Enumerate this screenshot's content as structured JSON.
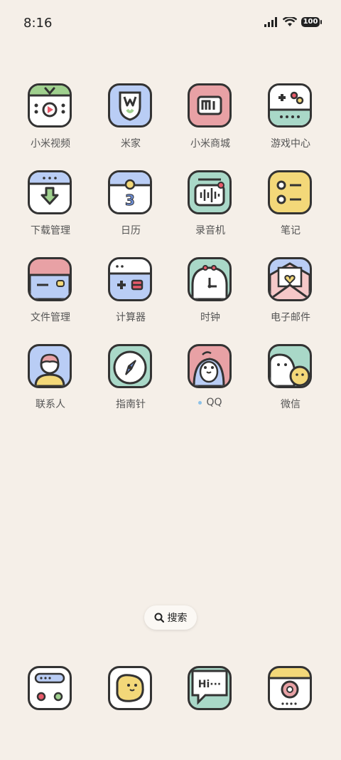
{
  "status": {
    "time": "8:16",
    "battery": "100",
    "icons": [
      "signal-icon",
      "wifi-icon",
      "battery-icon"
    ]
  },
  "apps": [
    {
      "label": "小米视频",
      "icon": "tv-play-icon"
    },
    {
      "label": "米家",
      "icon": "mijia-icon"
    },
    {
      "label": "小米商城",
      "icon": "mi-store-icon"
    },
    {
      "label": "游戏中心",
      "icon": "gamepad-icon"
    },
    {
      "label": "下载管理",
      "icon": "download-icon"
    },
    {
      "label": "日历",
      "icon": "calendar-icon",
      "day": "3"
    },
    {
      "label": "录音机",
      "icon": "recorder-icon"
    },
    {
      "label": "笔记",
      "icon": "notes-icon"
    },
    {
      "label": "文件管理",
      "icon": "folder-icon"
    },
    {
      "label": "计算器",
      "icon": "calculator-icon"
    },
    {
      "label": "时钟",
      "icon": "clock-icon"
    },
    {
      "label": "电子邮件",
      "icon": "mail-icon"
    },
    {
      "label": "联系人",
      "icon": "contacts-icon"
    },
    {
      "label": "指南针",
      "icon": "compass-icon"
    },
    {
      "label": "QQ",
      "icon": "qq-penguin-icon"
    },
    {
      "label": "微信",
      "icon": "wechat-icon"
    }
  ],
  "search": {
    "label": "搜索",
    "icon": "search-icon"
  },
  "dock": [
    {
      "icon": "settings-toggle-icon"
    },
    {
      "icon": "gallery-icon"
    },
    {
      "icon": "messages-icon",
      "text": "Hi···"
    },
    {
      "icon": "camera-icon"
    }
  ]
}
